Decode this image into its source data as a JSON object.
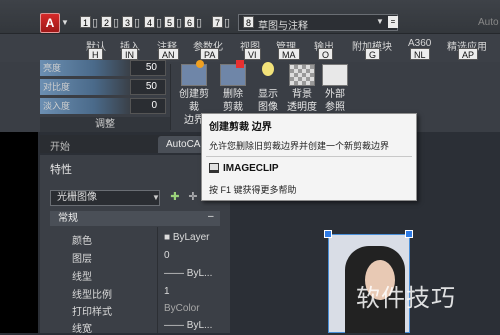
{
  "app_button": {
    "label": "A"
  },
  "quick_access": {
    "items": [
      {
        "key": "1",
        "glyph": "▯"
      },
      {
        "key": "2",
        "glyph": "▯"
      },
      {
        "key": "3",
        "glyph": "▯"
      },
      {
        "key": "4",
        "glyph": "▯"
      },
      {
        "key": "5",
        "glyph": "▯"
      },
      {
        "key": "6",
        "glyph": "▯"
      },
      {
        "key": "7",
        "glyph": "▯"
      }
    ]
  },
  "workspace": {
    "key": "8",
    "label": "草图与注释",
    "eq": "="
  },
  "title_text": "Auto",
  "ribbon_tabs": [
    {
      "label": "默认",
      "key": "H"
    },
    {
      "label": "插入",
      "key": "IN"
    },
    {
      "label": "注释",
      "key": "AN"
    },
    {
      "label": "参数化",
      "key": "PA"
    },
    {
      "label": "视图",
      "key": "VI"
    },
    {
      "label": "管理",
      "key": "MA"
    },
    {
      "label": "输出",
      "key": "O"
    },
    {
      "label": "附加模块",
      "key": "G"
    },
    {
      "label": "A360",
      "key": "NL"
    },
    {
      "label": "精选应用",
      "key": "AP"
    }
  ],
  "adjust_panel": {
    "title": "调整",
    "sliders": [
      {
        "label": "亮度",
        "value": "50"
      },
      {
        "label": "对比度",
        "value": "50"
      },
      {
        "label": "淡入度",
        "value": "0"
      }
    ]
  },
  "clip_buttons": [
    {
      "label_1": "创建剪裁",
      "label_2": "边界"
    },
    {
      "label_1": "删除",
      "label_2": "剪裁"
    },
    {
      "label_1": "显示",
      "label_2": "图像"
    },
    {
      "label_1": "背景",
      "label_2": "透明度"
    },
    {
      "label_1": "外部",
      "label_2": "参照"
    }
  ],
  "doc_tabs": {
    "start": "开始",
    "file": "AutoCA"
  },
  "properties": {
    "title": "特性",
    "selected_object": "光栅图像",
    "section": "常规",
    "section_toggle": "–",
    "rows": [
      {
        "label": "颜色",
        "value": "■ ByLayer"
      },
      {
        "label": "图层",
        "value": "0"
      },
      {
        "label": "线型",
        "value": "—— ByL..."
      },
      {
        "label": "线型比例",
        "value": "1"
      },
      {
        "label": "打印样式",
        "value": "ByColor"
      },
      {
        "label": "线宽",
        "value": "—— ByL..."
      }
    ]
  },
  "tooltip": {
    "title": "创建剪裁 边界",
    "description": "允许您删除旧剪裁边界并创建一个新剪裁边界",
    "command": "IMAGECLIP",
    "help": "按 F1 键获得更多帮助"
  },
  "watermark": "软件技巧",
  "colors": {
    "accent": "#2e7be6",
    "app_red": "#c52222",
    "ribbon_bg": "#3a3e45"
  }
}
